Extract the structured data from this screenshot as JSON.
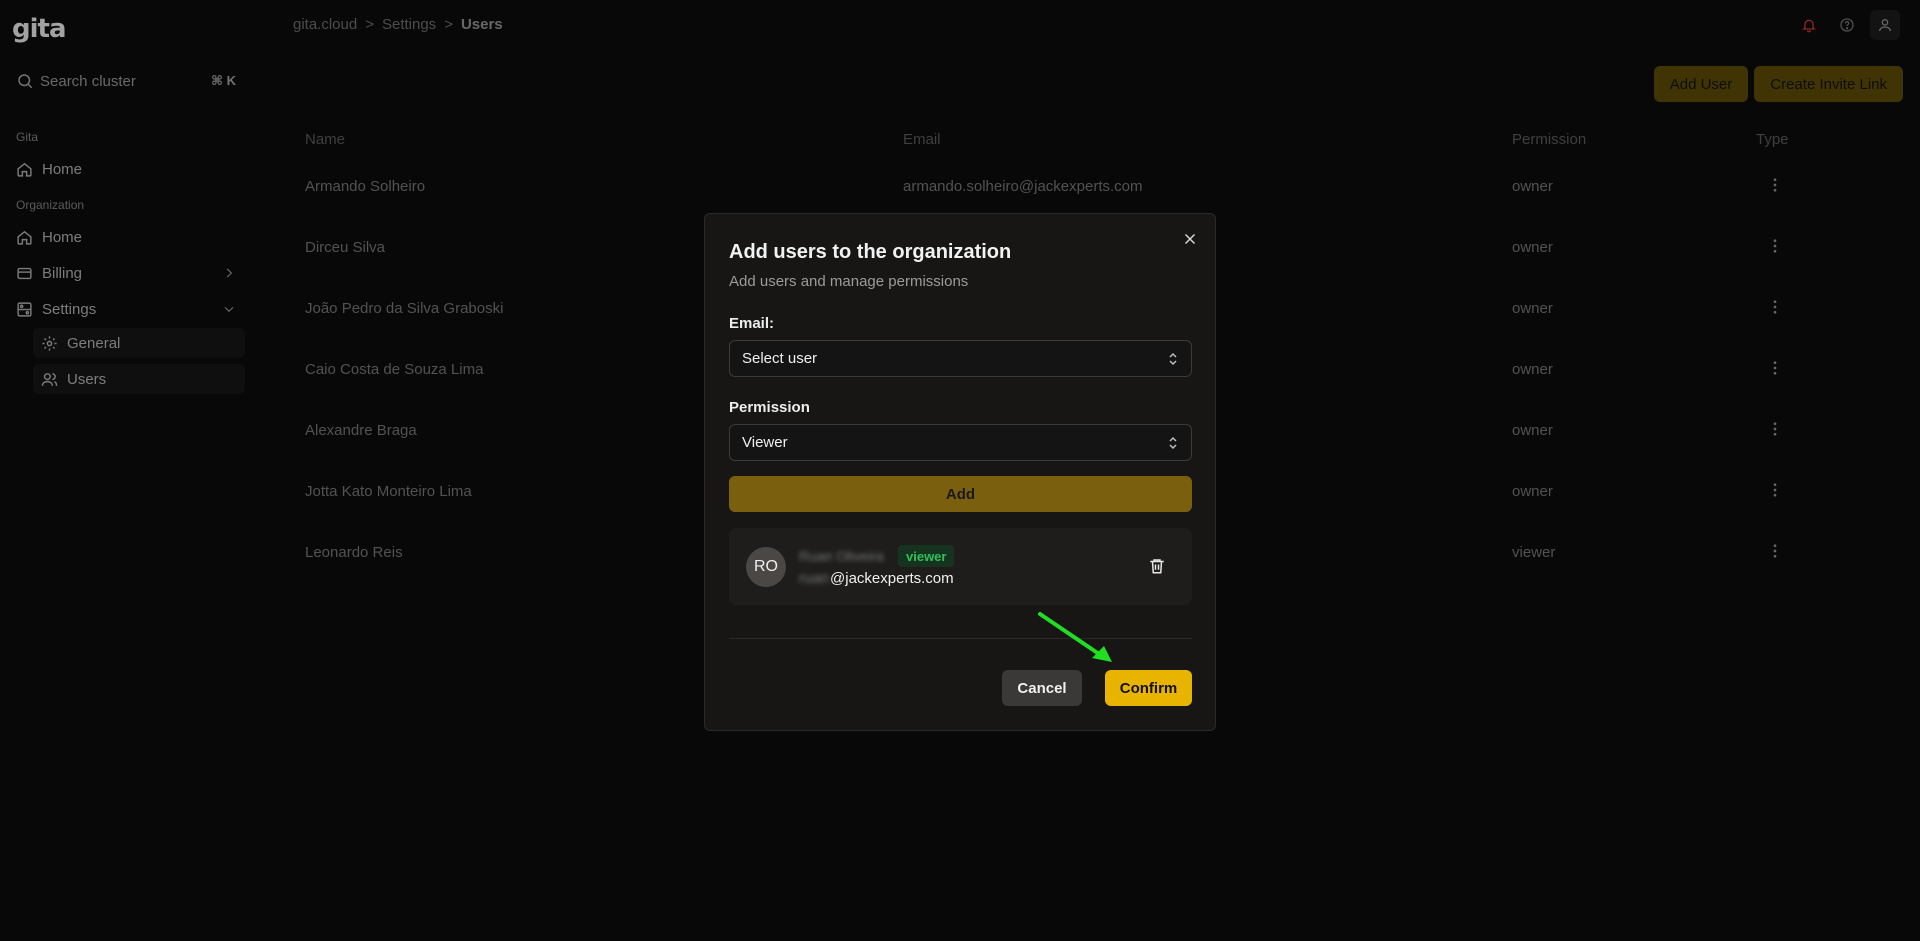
{
  "app": {
    "logo": "gita"
  },
  "search": {
    "placeholder": "Search cluster",
    "shortcut": "⌘ K"
  },
  "sidebar": {
    "sections": [
      {
        "label": "Gita"
      },
      {
        "label": "Organization"
      }
    ],
    "items": [
      {
        "label": "Home",
        "icon": "home-icon"
      },
      {
        "label": "Home",
        "icon": "home-icon"
      },
      {
        "label": "Billing",
        "icon": "credit-card-icon"
      },
      {
        "label": "Settings",
        "icon": "settings-icon"
      },
      {
        "label": "General",
        "icon": "gear-icon"
      },
      {
        "label": "Users",
        "icon": "users-icon"
      }
    ]
  },
  "breadcrumb": {
    "root": "gita.cloud",
    "sep": ">",
    "middle": "Settings",
    "current": "Users"
  },
  "header_icons": [
    "bell-icon",
    "help-icon",
    "user-icon"
  ],
  "actions": {
    "add_user": "Add User",
    "create_invite": "Create Invite Link"
  },
  "table": {
    "columns": {
      "name": "Name",
      "email": "Email",
      "permission": "Permission",
      "type": "Type"
    },
    "rows": [
      {
        "name": "Armando Solheiro",
        "email": "armando.solheiro@jackexperts.com",
        "permission": "owner"
      },
      {
        "name": "Dirceu Silva",
        "email": "",
        "permission": "owner"
      },
      {
        "name": "João Pedro da Silva Graboski",
        "email": "",
        "permission": "owner"
      },
      {
        "name": "Caio Costa de Souza Lima",
        "email": "",
        "permission": "owner"
      },
      {
        "name": "Alexandre Braga",
        "email": "",
        "permission": "owner"
      },
      {
        "name": "Jotta Kato Monteiro Lima",
        "email": "",
        "permission": "owner"
      },
      {
        "name": "Leonardo Reis",
        "email": "",
        "permission": "viewer"
      }
    ]
  },
  "modal": {
    "title": "Add users to the organization",
    "subtitle": "Add users and manage permissions",
    "email_label": "Email:",
    "email_select": "Select user",
    "permission_label": "Permission",
    "permission_select": "Viewer",
    "add_button": "Add",
    "pending_user": {
      "initials": "RO",
      "name": "Ruan Oliveira",
      "badge": "viewer",
      "email_prefix": "ruan",
      "email_domain": "@jackexperts.com"
    },
    "cancel": "Cancel",
    "confirm": "Confirm"
  },
  "colors": {
    "accent": "#e8b400",
    "accent_dim": "#574606",
    "badge_green": "#2fc05a",
    "annotation_arrow": "#22dd22"
  }
}
